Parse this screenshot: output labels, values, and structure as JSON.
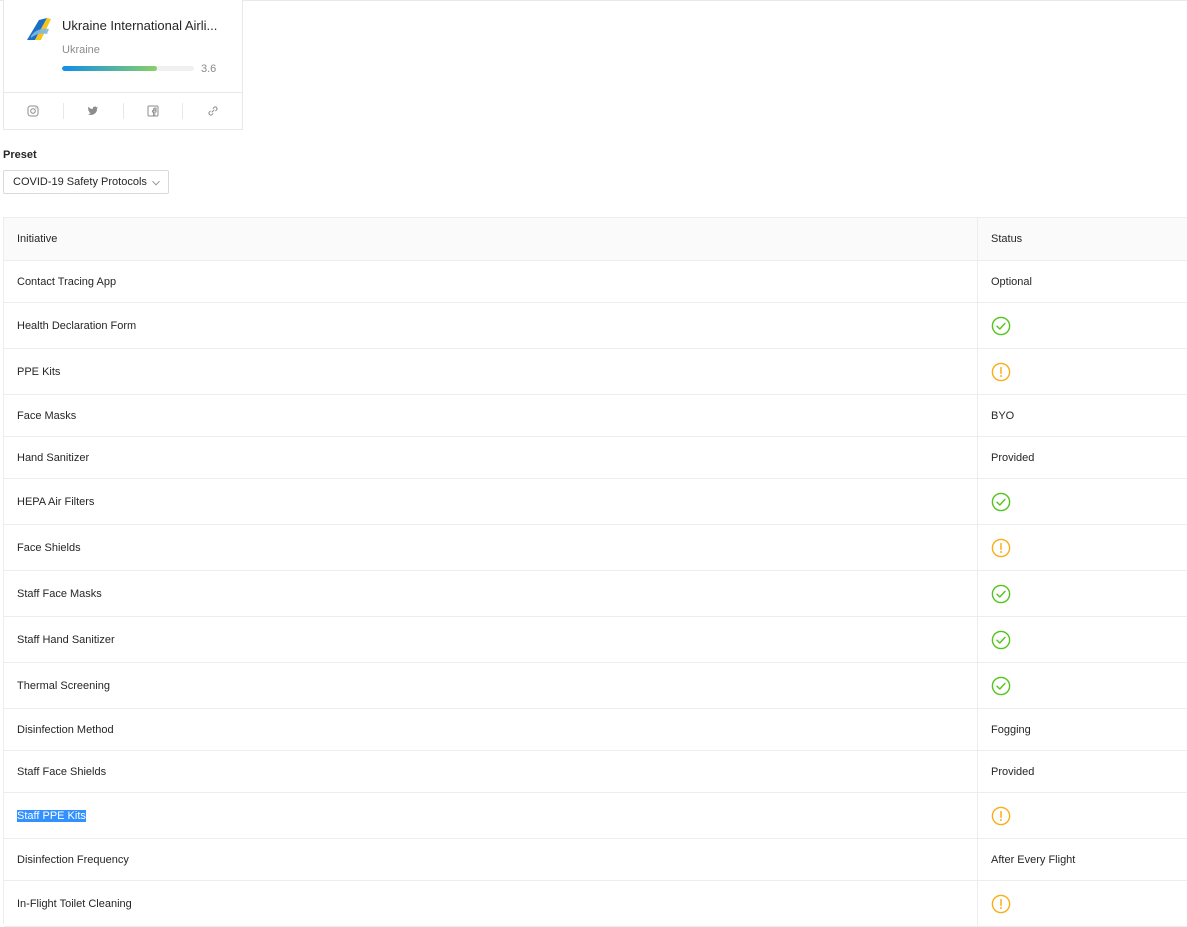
{
  "airline": {
    "name": "Ukraine International Airli...",
    "country": "Ukraine",
    "rating": 3.6,
    "rating_label": "3.6",
    "rating_fraction": 0.72,
    "logo_icon": "airline-tail-logo-icon",
    "social": [
      "instagram-icon",
      "twitter-icon",
      "facebook-icon",
      "link-icon"
    ]
  },
  "preset": {
    "label": "Preset",
    "value": "COVID-19 Safety Protocols"
  },
  "table": {
    "columns": [
      "Initiative",
      "Status"
    ],
    "rows": [
      {
        "initiative": "Contact Tracing App",
        "status": "Optional",
        "kind": "text"
      },
      {
        "initiative": "Health Declaration Form",
        "status": "check-circle-icon",
        "kind": "icon"
      },
      {
        "initiative": "PPE Kits",
        "status": "exclamation-circle-icon",
        "kind": "icon"
      },
      {
        "initiative": "Face Masks",
        "status": "BYO",
        "kind": "text"
      },
      {
        "initiative": "Hand Sanitizer",
        "status": "Provided",
        "kind": "text"
      },
      {
        "initiative": "HEPA Air Filters",
        "status": "check-circle-icon",
        "kind": "icon"
      },
      {
        "initiative": "Face Shields",
        "status": "exclamation-circle-icon",
        "kind": "icon"
      },
      {
        "initiative": "Staff Face Masks",
        "status": "check-circle-icon",
        "kind": "icon"
      },
      {
        "initiative": "Staff Hand Sanitizer",
        "status": "check-circle-icon",
        "kind": "icon"
      },
      {
        "initiative": "Thermal Screening",
        "status": "check-circle-icon",
        "kind": "icon"
      },
      {
        "initiative": "Disinfection Method",
        "status": "Fogging",
        "kind": "text"
      },
      {
        "initiative": "Staff Face Shields",
        "status": "Provided",
        "kind": "text"
      },
      {
        "initiative": "Staff PPE Kits",
        "status": "exclamation-circle-icon",
        "kind": "icon",
        "selected": true
      },
      {
        "initiative": "Disinfection Frequency",
        "status": "After Every Flight",
        "kind": "text"
      },
      {
        "initiative": "In-Flight Toilet Cleaning",
        "status": "exclamation-circle-icon",
        "kind": "icon"
      }
    ]
  },
  "colors": {
    "check": "#52c41a",
    "warning": "#faad14",
    "selection": "#3390ff",
    "rating_start": "#108ee9",
    "rating_end": "#87d068"
  }
}
